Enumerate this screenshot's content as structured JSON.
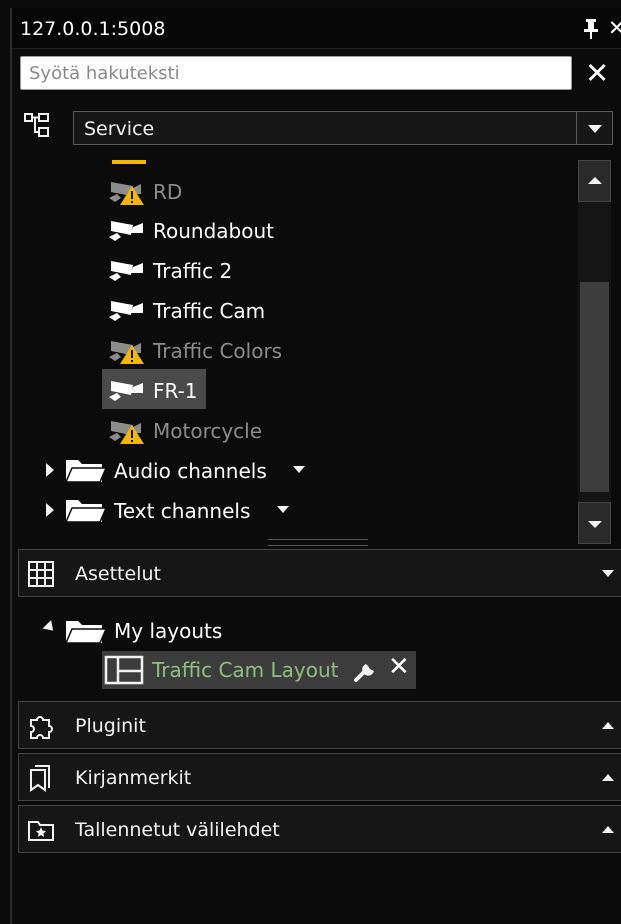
{
  "window": {
    "title": "127.0.0.1:5008",
    "pin_icon": "pin-icon",
    "close_icon": "close-icon"
  },
  "search": {
    "placeholder": "Syötä hakuteksti",
    "value": "",
    "clear_icon": "close-icon"
  },
  "tree_selector": {
    "icon": "tree-hierarchy-icon",
    "selected": "Service"
  },
  "tree": {
    "cameras": [
      {
        "label": "RD",
        "state": "warning"
      },
      {
        "label": "Roundabout",
        "state": "normal"
      },
      {
        "label": "Traffic 2",
        "state": "normal"
      },
      {
        "label": "Traffic Cam",
        "state": "normal"
      },
      {
        "label": "Traffic Colors",
        "state": "warning"
      },
      {
        "label": "FR-1",
        "state": "selected"
      },
      {
        "label": "Motorcycle",
        "state": "warning"
      }
    ],
    "folders": [
      {
        "label": "Audio channels"
      },
      {
        "label": "Text channels"
      }
    ]
  },
  "panels": {
    "layouts": {
      "title": "Asettelut",
      "icon": "grid-icon",
      "folder": "My layouts",
      "item": "Traffic Cam Layout",
      "item_icons": [
        "layout-icon",
        "wrench-icon",
        "close-icon"
      ]
    },
    "plugins": {
      "title": "Pluginit",
      "icon": "puzzle-icon"
    },
    "bookmarks": {
      "title": "Kirjanmerkit",
      "icon": "bookmark-icon"
    },
    "saved_tabs": {
      "title": "Tallennetut välilehdet",
      "icon": "star-folder-icon"
    }
  },
  "colors": {
    "background": "#0b0b0b",
    "warning": "#f2b705",
    "layout_item_text": "#8ec07e"
  }
}
